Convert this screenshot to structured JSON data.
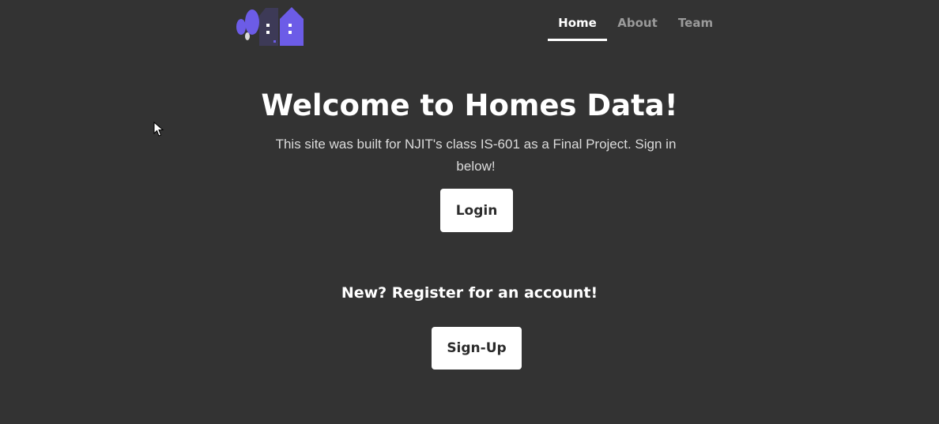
{
  "nav": {
    "items": [
      {
        "label": "Home",
        "active": true
      },
      {
        "label": "About",
        "active": false
      },
      {
        "label": "Team",
        "active": false
      }
    ]
  },
  "logo": {
    "icon": "house-trees-logo-icon",
    "colors": {
      "primary": "#6c5ce7",
      "dark": "#3d3a57",
      "light": "#ffffff"
    }
  },
  "hero": {
    "title": "Welcome to Homes Data!",
    "subtitle": "This site was built for NJIT's class IS-601 as a Final Project. Sign in below!"
  },
  "actions": {
    "login_label": "Login",
    "register_prompt": "New? Register for an account!",
    "signup_label": "Sign-Up"
  },
  "colors": {
    "background": "#333333",
    "text": "#ffffff",
    "muted_text": "#9a9a9a",
    "button_bg": "#ffffff"
  }
}
